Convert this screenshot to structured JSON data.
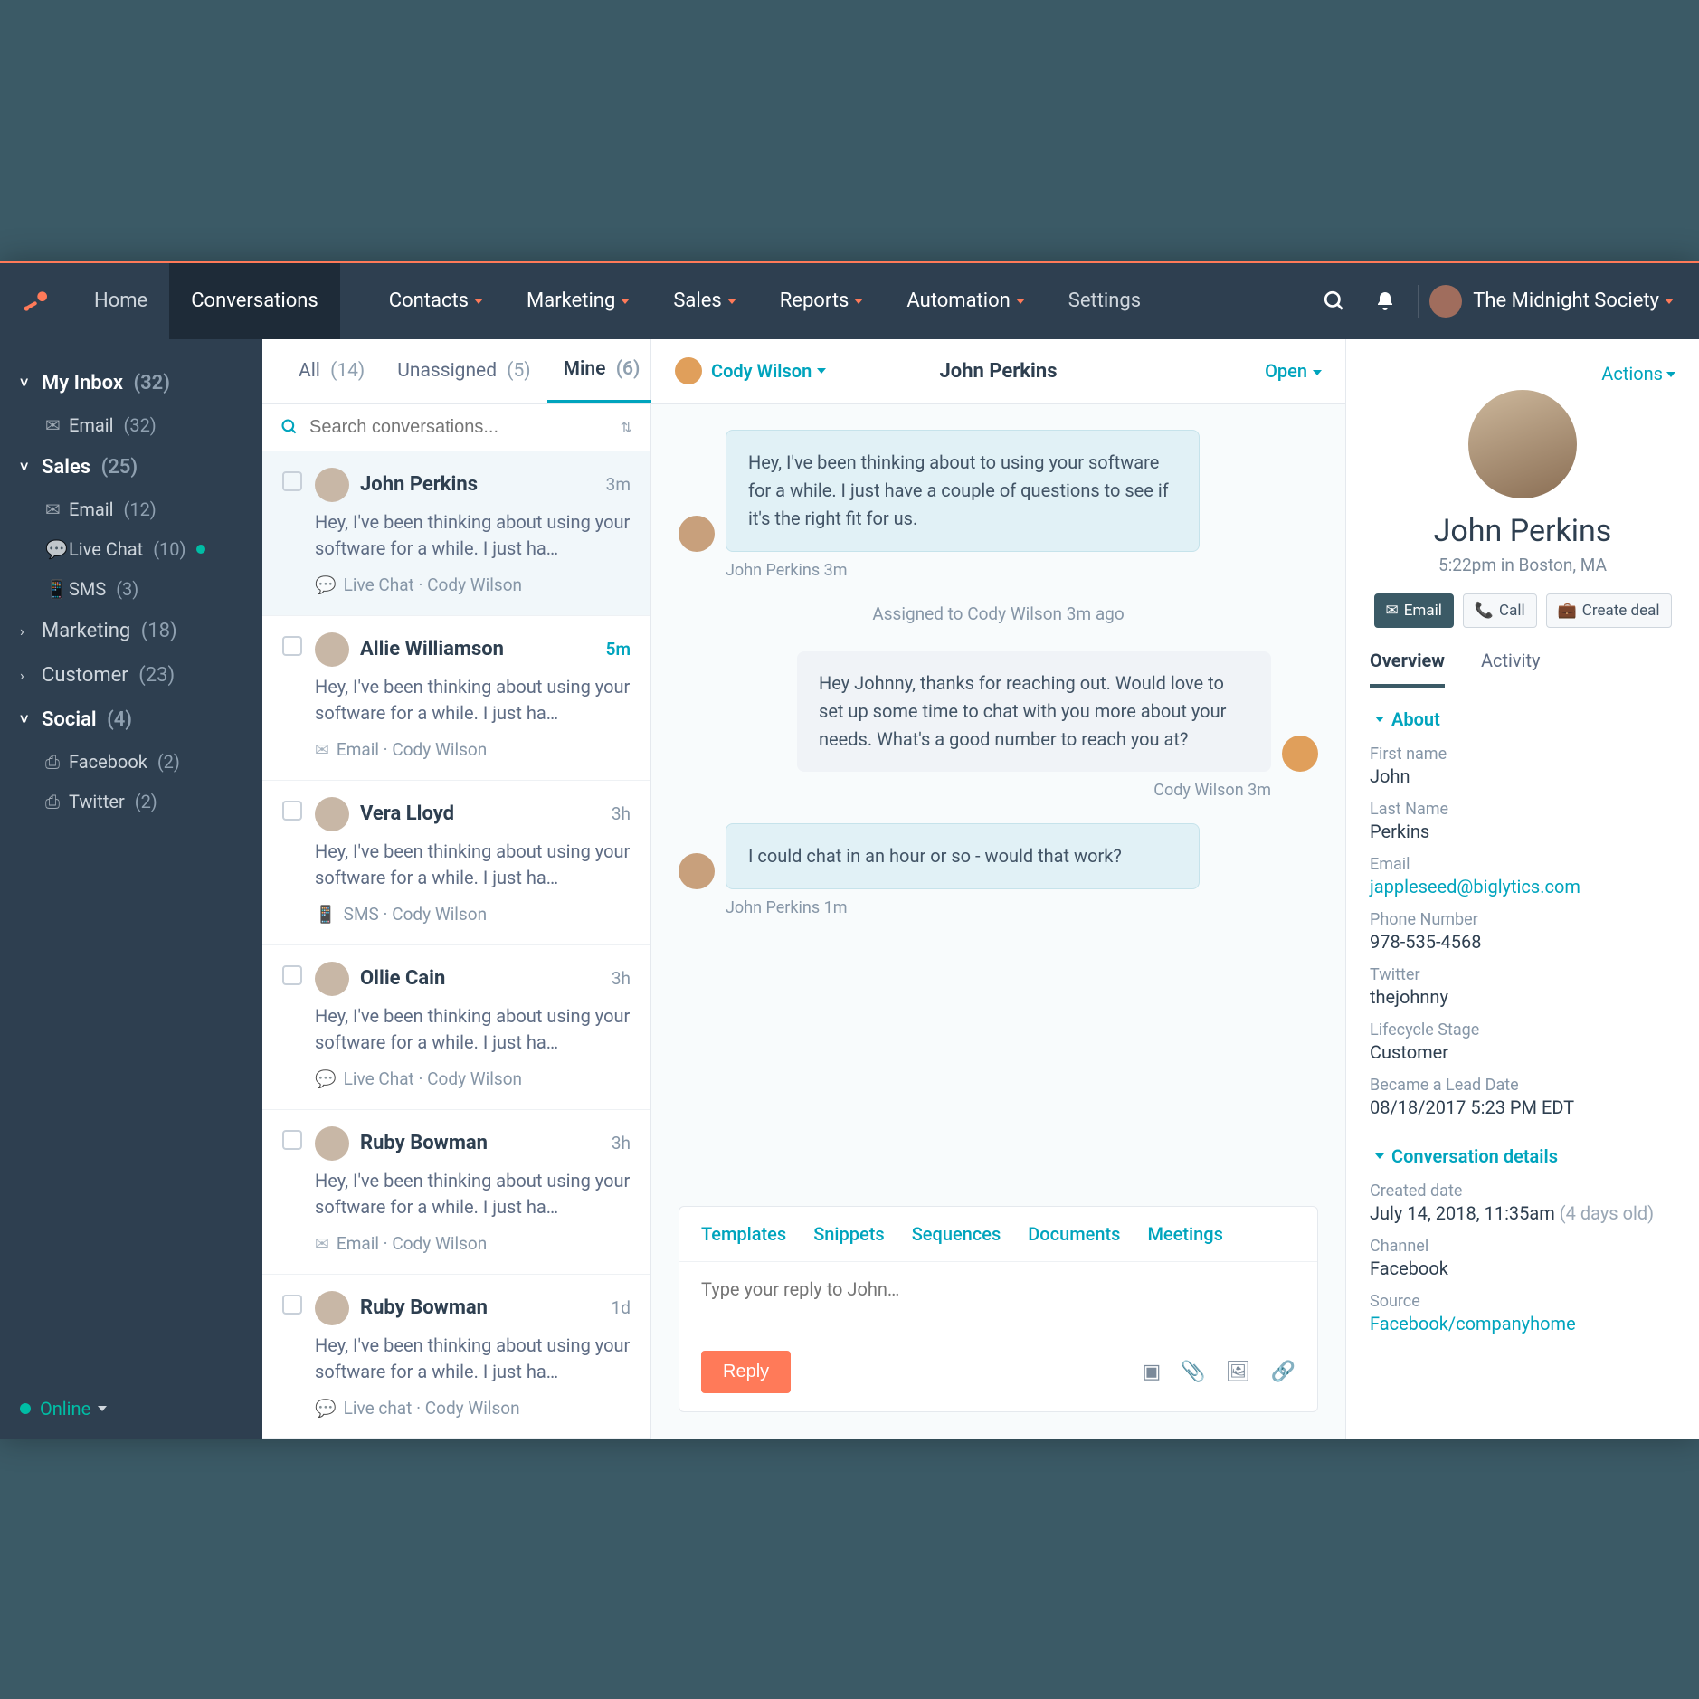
{
  "nav": {
    "home": "Home",
    "conversations": "Conversations",
    "contacts": "Contacts",
    "marketing": "Marketing",
    "sales": "Sales",
    "reports": "Reports",
    "automation": "Automation",
    "settings": "Settings",
    "account": "The Midnight Society"
  },
  "sidebar": {
    "groups": [
      {
        "title": "My Inbox",
        "count": "(32)",
        "open": true,
        "items": [
          {
            "icon": "✉",
            "label": "Email",
            "count": "(32)"
          }
        ]
      },
      {
        "title": "Sales",
        "count": "(25)",
        "open": true,
        "items": [
          {
            "icon": "✉",
            "label": "Email",
            "count": "(12)"
          },
          {
            "icon": "💬",
            "label": "Live Chat",
            "count": "(10)",
            "dot": true
          },
          {
            "icon": "📱",
            "label": "SMS",
            "count": "(3)"
          }
        ]
      },
      {
        "title": "Marketing",
        "count": "(18)",
        "open": false
      },
      {
        "title": "Customer",
        "count": "(23)",
        "open": false
      },
      {
        "title": "Social",
        "count": "(4)",
        "open": true,
        "items": [
          {
            "icon": "⎙",
            "label": "Facebook",
            "count": "(2)"
          },
          {
            "icon": "⎙",
            "label": "Twitter",
            "count": "(2)"
          }
        ]
      }
    ],
    "status": "Online"
  },
  "tabs": {
    "all": {
      "label": "All",
      "count": "(14)"
    },
    "unassigned": {
      "label": "Unassigned",
      "count": "(5)"
    },
    "mine": {
      "label": "Mine",
      "count": "(6)"
    },
    "filter": "Filter"
  },
  "search": {
    "placeholder": "Search conversations..."
  },
  "convos": [
    {
      "name": "John Perkins",
      "time": "3m",
      "preview": "Hey, I've been thinking about using your software for a while. I just ha…",
      "meta_icon": "💬",
      "meta": "Live Chat · Cody Wilson",
      "selected": true
    },
    {
      "name": "Allie Williamson",
      "time": "5m",
      "new": true,
      "preview": "Hey, I've been thinking about using your software for a while. I just ha…",
      "meta_icon": "✉",
      "meta": "Email · Cody Wilson"
    },
    {
      "name": "Vera Lloyd",
      "time": "3h",
      "preview": "Hey, I've been thinking about using your software for a while. I just ha…",
      "meta_icon": "📱",
      "meta": "SMS · Cody Wilson"
    },
    {
      "name": "Ollie Cain",
      "time": "3h",
      "preview": "Hey, I've been thinking about using your software for a while. I just ha…",
      "meta_icon": "💬",
      "meta": "Live Chat · Cody Wilson"
    },
    {
      "name": "Ruby Bowman",
      "time": "3h",
      "preview": "Hey, I've been thinking about using your software for a while. I just ha…",
      "meta_icon": "✉",
      "meta": "Email · Cody Wilson"
    },
    {
      "name": "Ruby Bowman",
      "time": "1d",
      "preview": "Hey, I've been thinking about using your software for a while. I just ha…",
      "meta_icon": "💬",
      "meta": "Live chat · Cody Wilson"
    }
  ],
  "thread": {
    "assignee": "Cody Wilson",
    "title": "John Perkins",
    "status": "Open",
    "messages": {
      "m1_text": "Hey, I've been thinking about to using your software for a while. I just have a couple of questions to see if it's the right fit for us.",
      "m1_meta": "John Perkins 3m",
      "sys": "Assigned to Cody Wilson 3m ago",
      "m2_text": "Hey Johnny, thanks for reaching out. Would love to set up some time to chat with you more about your needs. What's a good number to reach you at?",
      "m2_meta": "Cody Wilson 3m",
      "m3_text": "I could chat in an hour or so - would that work?",
      "m3_meta": "John Perkins 1m"
    },
    "composer": {
      "tabs": {
        "templates": "Templates",
        "snippets": "Snippets",
        "sequences": "Sequences",
        "documents": "Documents",
        "meetings": "Meetings"
      },
      "placeholder": "Type your reply to John…",
      "reply": "Reply"
    }
  },
  "profile": {
    "actions": "Actions",
    "name": "John Perkins",
    "subtitle": "5:22pm in Boston, MA",
    "buttons": {
      "email": "Email",
      "call": "Call",
      "create_deal": "Create deal"
    },
    "tabs": {
      "overview": "Overview",
      "activity": "Activity"
    },
    "about_title": "About",
    "fields": {
      "first_name_label": "First name",
      "first_name": "John",
      "last_name_label": "Last Name",
      "last_name": "Perkins",
      "email_label": "Email",
      "email": "jappleseed@biglytics.com",
      "phone_label": "Phone Number",
      "phone": "978-535-4568",
      "twitter_label": "Twitter",
      "twitter": "thejohnny",
      "lifecycle_label": "Lifecycle Stage",
      "lifecycle": "Customer",
      "lead_date_label": "Became a Lead Date",
      "lead_date": "08/18/2017 5:23 PM EDT"
    },
    "details_title": "Conversation details",
    "details": {
      "created_label": "Created date",
      "created": "July 14, 2018, 11:35am",
      "created_age": "(4 days old)",
      "channel_label": "Channel",
      "channel": "Facebook",
      "source_label": "Source",
      "source": "Facebook/companyhome"
    }
  }
}
